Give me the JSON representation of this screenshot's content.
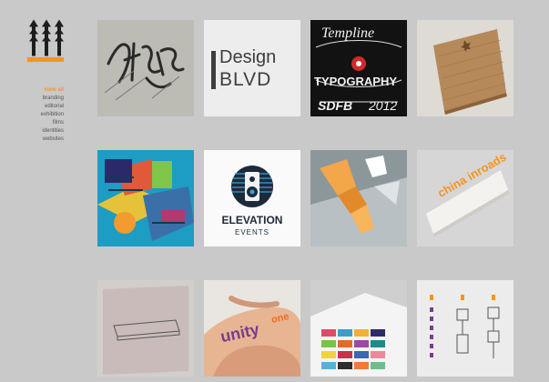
{
  "nav": {
    "items": [
      "view all",
      "branding",
      "editorial",
      "exhibition",
      "films",
      "identities",
      "websites"
    ]
  },
  "tiles": {
    "design_blvd": {
      "line1": "Design",
      "line2": "BLVD"
    },
    "typography": {
      "line1": "Templine",
      "line2": "TYPOGRAPHY",
      "line3": "SDFB",
      "line4": "2012"
    },
    "elevation": {
      "title": "ELEVATION",
      "subtitle": "EVENTS"
    },
    "china": {
      "text": "china inroads"
    },
    "unity": {
      "text": "unity",
      "suffix": "one"
    }
  },
  "colors": {
    "accent": "#f7941d",
    "background": "#c9c9c9"
  }
}
